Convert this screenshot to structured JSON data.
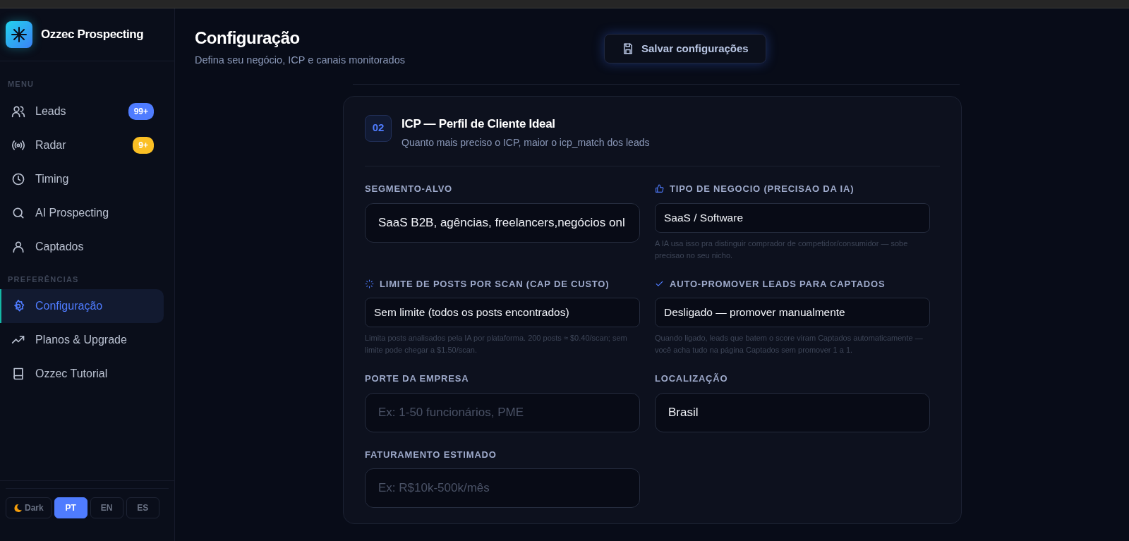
{
  "sidebar": {
    "brand": "Ozzec Prospecting",
    "sections": [
      {
        "title": "MENU",
        "items": [
          {
            "label": "Leads",
            "selected": false,
            "badge": {
              "text": "99+",
              "color": "#4f7cff"
            }
          },
          {
            "label": "Radar",
            "selected": false,
            "badge": {
              "text": "9+",
              "color": "#fbbf24"
            }
          },
          {
            "label": "Timing",
            "selected": false
          },
          {
            "label": "AI Prospecting",
            "selected": false
          },
          {
            "label": "Captados",
            "selected": false
          }
        ]
      },
      {
        "title": "PREFERÊNCIAS",
        "items": [
          {
            "label": "Configuração",
            "selected": true
          },
          {
            "label": "Planos & Upgrade",
            "selected": false
          },
          {
            "label": "Ozzec Tutorial",
            "selected": false
          }
        ]
      }
    ],
    "theme_toggle": "Dark",
    "languages": [
      {
        "label": "PT",
        "selected": true
      },
      {
        "label": "EN",
        "selected": false
      },
      {
        "label": "ES",
        "selected": false
      }
    ]
  },
  "header": {
    "title": "Configuração",
    "subtitle": "Defina seu negócio, ICP e canais monitorados",
    "save_button": "Salvar configurações"
  },
  "section": {
    "number": "02",
    "title": "ICP — Perfil de Cliente Ideal",
    "subtitle": "Quanto mais preciso o ICP, maior o icp_match dos leads",
    "fields": [
      {
        "label": "SEGMENTO-ALVO",
        "kind": "text",
        "value": "SaaS B2B, agências, freelancers,negócios onl"
      },
      {
        "label": "TIPO DE NEGOCIO (PRECISAO DA IA)",
        "kind": "select",
        "value": "SaaS / Software",
        "help": "A IA usa isso pra distinguir comprador de competidor/consumidor — sobe precisao no seu nicho."
      },
      {
        "label": "LIMITE DE POSTS POR SCAN (CAP DE CUSTO)",
        "kind": "select",
        "value": "Sem limite (todos os posts encontrados)",
        "help": "Limita posts analisados pela IA por plataforma. 200 posts ≈ $0.40/scan; sem limite pode chegar a $1.50/scan."
      },
      {
        "label": "AUTO-PROMOVER LEADS PARA CAPTADOS",
        "kind": "select",
        "value": "Desligado — promover manualmente",
        "help": "Quando ligado, leads que batem o score viram Captados automaticamente — você acha tudo na página Captados sem promover 1 a 1."
      },
      {
        "label": "PORTE DA EMPRESA",
        "kind": "text",
        "placeholder": "Ex: 1-50 funcionários, PME"
      },
      {
        "label": "LOCALIZAÇÃO",
        "kind": "text",
        "value": "Brasil"
      },
      {
        "label": "FATURAMENTO ESTIMADO",
        "kind": "text",
        "placeholder": "Ex: R$10k-500k/mês"
      }
    ]
  }
}
